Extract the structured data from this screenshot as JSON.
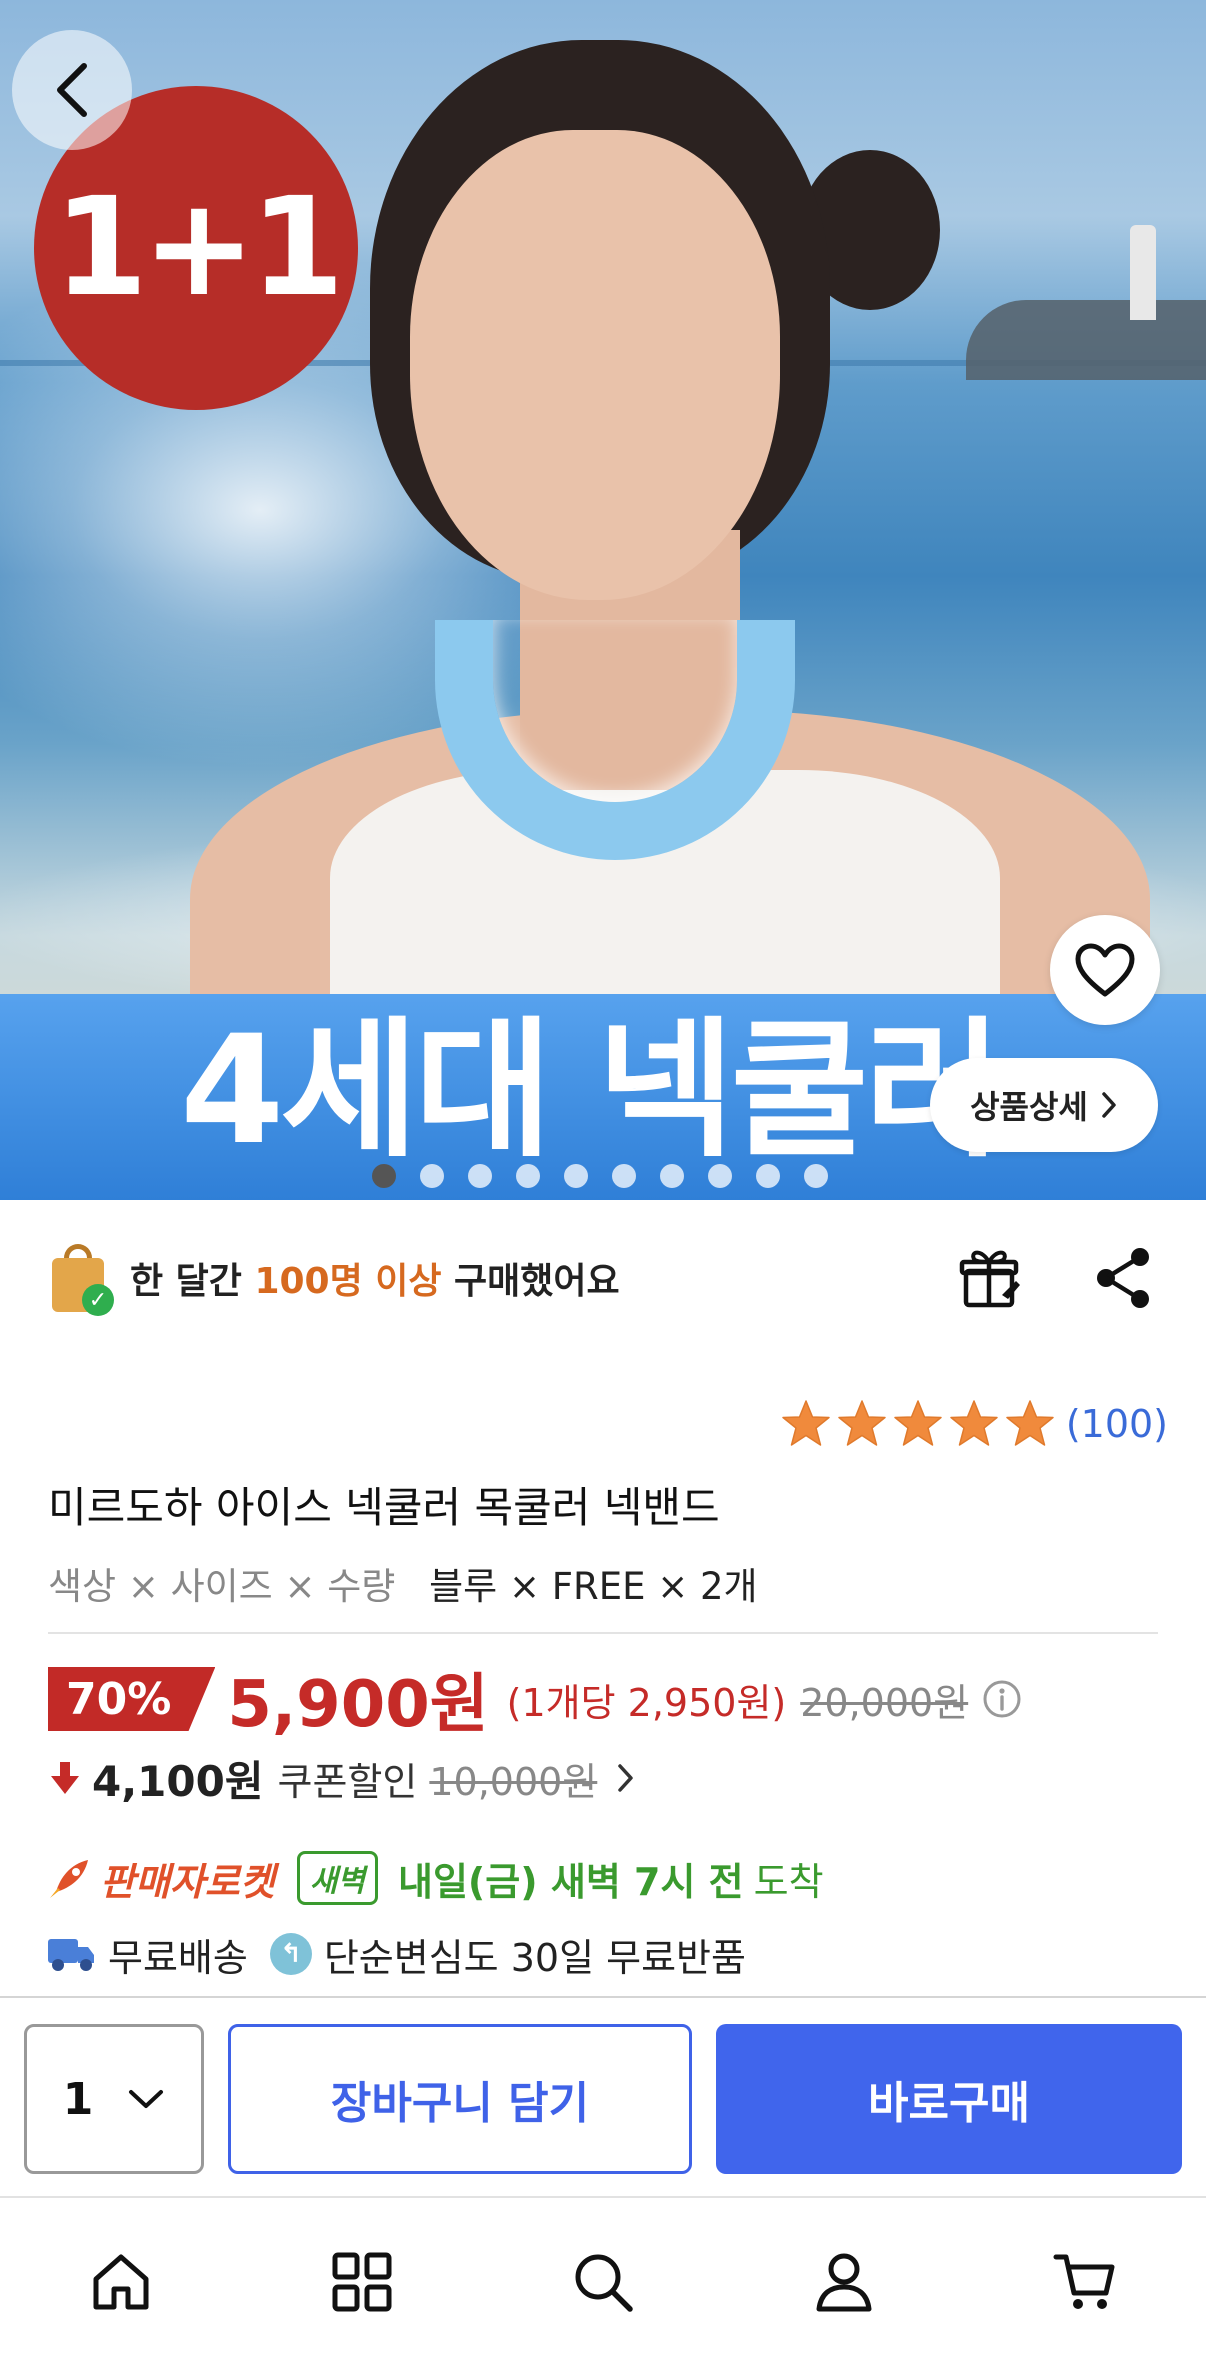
{
  "hero": {
    "badge": "1+1",
    "banner_text": "4세대 넥쿨러",
    "detail_label": "상품상세",
    "slide_count": 10,
    "active_slide": 1
  },
  "purchase": {
    "prefix": "한 달간 ",
    "highlight": "100명 이상",
    "suffix": " 구매했어요"
  },
  "rating": {
    "stars": 5,
    "count": "(100)"
  },
  "product": {
    "title": "미르도하 아이스 넥쿨러 목쿨러 넥밴드",
    "option_labels": "색상 × 사이즈 × 수량",
    "option_values": "블루 × FREE × 2개"
  },
  "price": {
    "discount": "70%",
    "sale_price": "5,900원",
    "unit_price": "(1개당 2,950원)",
    "original_price": "20,000원"
  },
  "coupon": {
    "amount": "4,100원",
    "label": "쿠폰할인",
    "original": "10,000원"
  },
  "delivery": {
    "rocket_label": "판매자로켓",
    "dawn_badge": "새벽",
    "arrival": "내일(금) 새벽 7시 전",
    "arrival_suffix": "도착",
    "free_shipping": "무료배송",
    "return_policy": "단순변심도 30일 무료반품"
  },
  "actions": {
    "quantity": "1",
    "cart_label": "장바구니 담기",
    "buy_label": "바로구매"
  },
  "tabs": [
    "home-icon",
    "category-icon",
    "search-icon",
    "user-icon",
    "cart-icon"
  ],
  "colors": {
    "accent": "#4065ec",
    "price": "#c52b28",
    "rocket": "#e0512a",
    "delivery": "#3a9a2e",
    "star": "#f08a3c"
  }
}
